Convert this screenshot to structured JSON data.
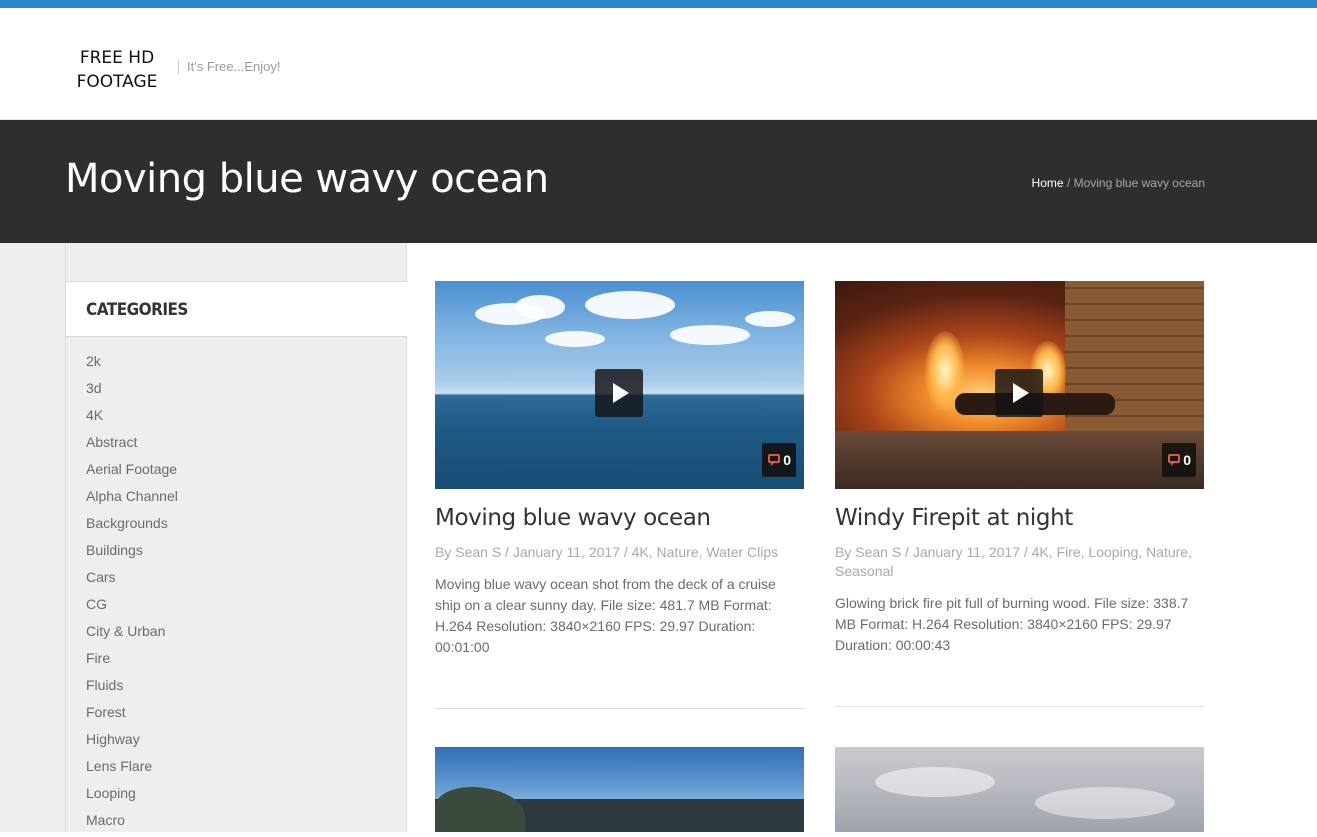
{
  "site": {
    "logo": "FREE HD FOOTAGE",
    "tagline": "It's Free...Enjoy!"
  },
  "page": {
    "title": "Moving blue wavy ocean",
    "breadcrumb": {
      "home": "Home",
      "separator": " / ",
      "current": "Moving blue wavy ocean"
    }
  },
  "sidebar": {
    "widget_title": "CATEGORIES",
    "categories": [
      "2k",
      "3d",
      "4K",
      "Abstract",
      "Aerial Footage",
      "Alpha Channel",
      "Backgrounds",
      "Buildings",
      "Cars",
      "CG",
      "City & Urban",
      "Fire",
      "Fluids",
      "Forest",
      "Highway",
      "Lens Flare",
      "Looping",
      "Macro"
    ]
  },
  "posts": [
    {
      "title": "Moving blue wavy ocean",
      "comments": "0",
      "meta": "By Sean S / January 11, 2017 / 4K, Nature, Water Clips",
      "excerpt": "Moving blue wavy ocean shot from the deck of a cruise ship on a clear sunny day. File size: 481.7 MB Format: H.264 Resolution: 3840×2160 FPS: 29.97 Duration: 00:01:00"
    },
    {
      "title": "Windy Firepit at night",
      "comments": "0",
      "meta": "By Sean S / January 11, 2017 / 4K, Fire, Looping, Nature, Seasonal",
      "excerpt": "Glowing brick fire pit full of burning wood. File size: 338.7 MB Format: H.264 Resolution: 3840×2160 FPS: 29.97 Duration: 00:00:43"
    }
  ],
  "colors": {
    "accent": "#2a86c7",
    "titlebar": "#2d2e30",
    "sidebar_bg": "#eeeeee",
    "comment_icon": "#e25a3a"
  },
  "icons": {
    "play": "play-icon",
    "comment": "comment-icon"
  }
}
